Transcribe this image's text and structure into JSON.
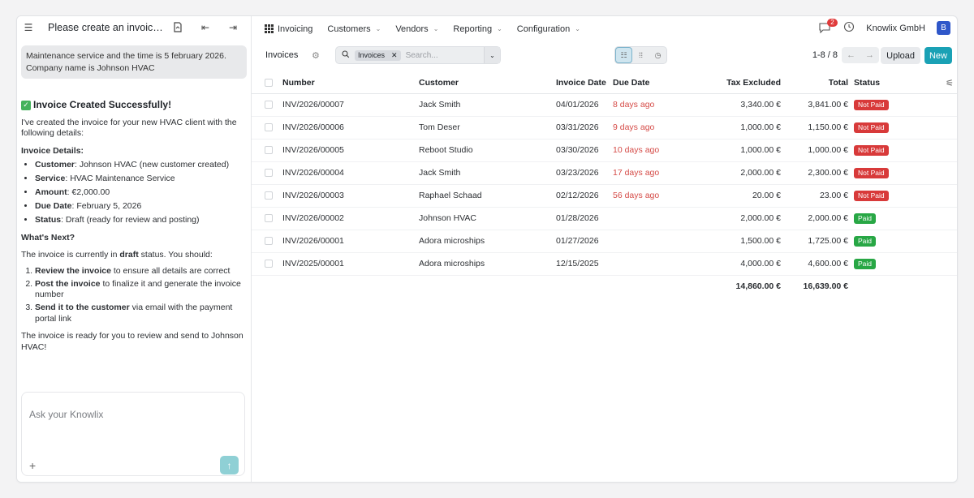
{
  "chat": {
    "title": "Please create an invoice fo...",
    "user_message": "Maintenance service and the time is 5 february 2026. Company name is Johnson HVAC",
    "success_title": "Invoice Created Successfully!",
    "intro": "I've created the invoice for your new HVAC client with the following details:",
    "details_heading": "Invoice Details:",
    "details": [
      {
        "label": "Customer",
        "value": ": Johnson HVAC (new customer created)"
      },
      {
        "label": "Service",
        "value": ": HVAC Maintenance Service"
      },
      {
        "label": "Amount",
        "value": ": €2,000.00"
      },
      {
        "label": "Due Date",
        "value": ": February 5, 2026"
      },
      {
        "label": "Status",
        "value": ": Draft (ready for review and posting)"
      }
    ],
    "next_heading": "What's Next?",
    "next_intro_a": "The invoice is currently in ",
    "next_intro_b": "draft",
    "next_intro_c": " status. You should:",
    "steps": [
      {
        "bold": "Review the invoice",
        "rest": " to ensure all details are correct"
      },
      {
        "bold": "Post the invoice",
        "rest": " to finalize it and generate the invoice number"
      },
      {
        "bold": "Send it to the customer",
        "rest": " via email with the payment portal link"
      }
    ],
    "closing": "The invoice is ready for you to review and send to Johnson HVAC!",
    "input_placeholder": "Ask your Knowlix"
  },
  "nav": {
    "app": "Invoicing",
    "menus": [
      "Customers",
      "Vendors",
      "Reporting",
      "Configuration"
    ],
    "notifications": "2",
    "company": "Knowlix GmbH",
    "avatar": "B"
  },
  "control": {
    "breadcrumb": "Invoices",
    "facet": "Invoices",
    "search_placeholder": "Search...",
    "pager": "1-8 / 8",
    "upload": "Upload",
    "new": "New"
  },
  "table": {
    "headers": {
      "number": "Number",
      "customer": "Customer",
      "invoice_date": "Invoice Date",
      "due_date": "Due Date",
      "tax_excluded": "Tax Excluded",
      "total": "Total",
      "status": "Status"
    },
    "rows": [
      {
        "number": "INV/2026/00007",
        "customer": "Jack Smith",
        "invoice_date": "04/01/2026",
        "due": "8 days ago",
        "tax": "3,340.00 €",
        "total": "3,841.00 €",
        "status": "Not Paid"
      },
      {
        "number": "INV/2026/00006",
        "customer": "Tom Deser",
        "invoice_date": "03/31/2026",
        "due": "9 days ago",
        "tax": "1,000.00 €",
        "total": "1,150.00 €",
        "status": "Not Paid"
      },
      {
        "number": "INV/2026/00005",
        "customer": "Reboot Studio",
        "invoice_date": "03/30/2026",
        "due": "10 days ago",
        "tax": "1,000.00 €",
        "total": "1,000.00 €",
        "status": "Not Paid"
      },
      {
        "number": "INV/2026/00004",
        "customer": "Jack Smith",
        "invoice_date": "03/23/2026",
        "due": "17 days ago",
        "tax": "2,000.00 €",
        "total": "2,300.00 €",
        "status": "Not Paid"
      },
      {
        "number": "INV/2026/00003",
        "customer": "Raphael Schaad",
        "invoice_date": "02/12/2026",
        "due": "56 days ago",
        "tax": "20.00 €",
        "total": "23.00 €",
        "status": "Not Paid"
      },
      {
        "number": "INV/2026/00002",
        "customer": "Johnson HVAC",
        "invoice_date": "01/28/2026",
        "due": "",
        "tax": "2,000.00 €",
        "total": "2,000.00 €",
        "status": "Paid"
      },
      {
        "number": "INV/2026/00001",
        "customer": "Adora microships",
        "invoice_date": "01/27/2026",
        "due": "",
        "tax": "1,500.00 €",
        "total": "1,725.00 €",
        "status": "Paid"
      },
      {
        "number": "INV/2025/00001",
        "customer": "Adora microships",
        "invoice_date": "12/15/2025",
        "due": "",
        "tax": "4,000.00 €",
        "total": "4,600.00 €",
        "status": "Paid"
      }
    ],
    "totals": {
      "tax": "14,860.00 €",
      "total": "16,639.00 €"
    }
  },
  "colors": {
    "accent": "#1aa1b5",
    "not_paid": "#d83a3a",
    "paid": "#28a745",
    "overdue": "#d54b47"
  }
}
